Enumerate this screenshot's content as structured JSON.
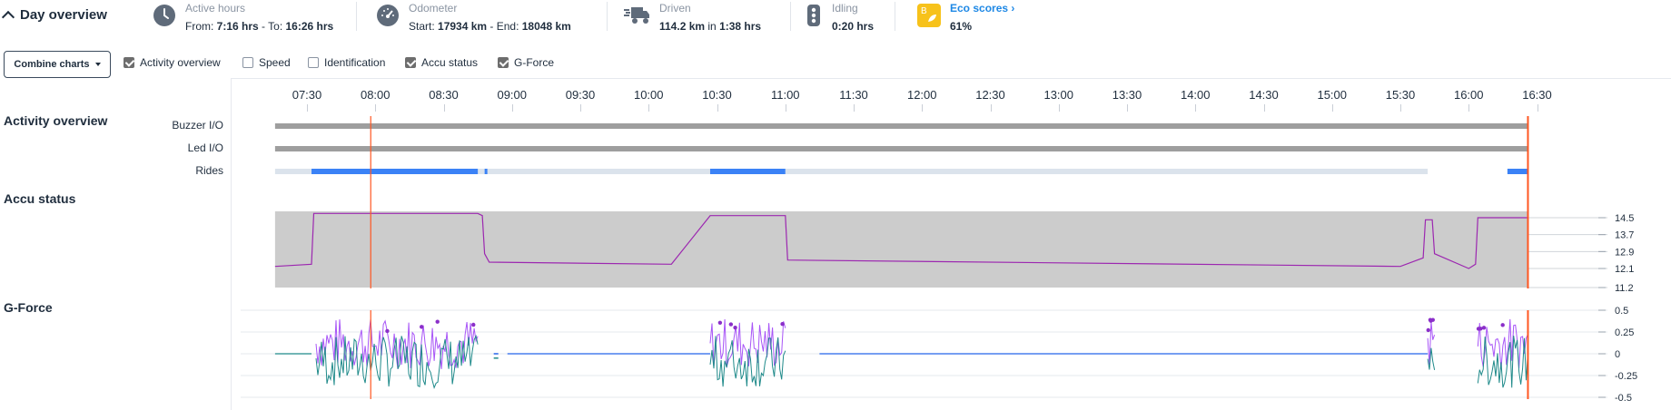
{
  "header": {
    "title": "Day overview",
    "stats": [
      {
        "icon": "clock-icon",
        "label": "Active hours",
        "prefix1": "From: ",
        "v1": "7:16 hrs",
        "mid": " - To: ",
        "v2": "16:26 hrs"
      },
      {
        "icon": "speedometer-icon",
        "label": "Odometer",
        "prefix1": "Start: ",
        "v1": "17934 km",
        "mid": " - End: ",
        "v2": "18048 km"
      },
      {
        "icon": "truck-icon",
        "label": "Driven",
        "prefix1": "",
        "v1": "114.2 km",
        "mid": " in ",
        "v2": "1:38 hrs"
      },
      {
        "icon": "traffic-light-icon",
        "label": "Idling",
        "prefix1": "",
        "v1": "0:20 hrs",
        "mid": "",
        "v2": ""
      },
      {
        "icon": "eco-badge-icon",
        "label": "Eco scores ›",
        "prefix1": "",
        "v1": "61%",
        "mid": "",
        "v2": ""
      }
    ],
    "eco_badge_letter": "B"
  },
  "controls": {
    "combine_label": "Combine charts",
    "checkboxes": [
      {
        "label": "Activity overview",
        "checked": true
      },
      {
        "label": "Speed",
        "checked": false
      },
      {
        "label": "Identification",
        "checked": false
      },
      {
        "label": "Accu status",
        "checked": true
      },
      {
        "label": "G-Force",
        "checked": true
      }
    ]
  },
  "timeline": {
    "ticks": [
      "07:30",
      "08:00",
      "08:30",
      "09:00",
      "09:30",
      "10:00",
      "10:30",
      "11:00",
      "11:30",
      "12:00",
      "12:30",
      "13:00",
      "13:30",
      "14:00",
      "14:30",
      "15:00",
      "15:30",
      "16:00",
      "16:30"
    ]
  },
  "sections": {
    "activity_title": "Activity overview",
    "accu_title": "Accu status",
    "gforce_title": "G-Force"
  },
  "activity_rows": [
    "Buzzer I/O",
    "Led I/O",
    "Rides"
  ],
  "colors": {
    "bar_gray": "#9e9e9e",
    "ride_active": "#3b82f6",
    "ride_idle": "#dbe3ec",
    "marker": "#ff5722",
    "accu_fill": "#cccccc",
    "accu_line": "#9c27b0",
    "gforce_purple": "#a855f7",
    "gforce_teal": "#1f8a8a",
    "gforce_blue": "#2563eb",
    "eco_yellow": "#f7c21b",
    "eco_blue": "#1e88e5"
  },
  "chart_data": [
    {
      "type": "bar",
      "title": "Activity overview",
      "x_unit": "time",
      "series": [
        {
          "name": "Buzzer I/O",
          "segments": [
            [
              "07:16",
              "16:26"
            ]
          ]
        },
        {
          "name": "Led I/O",
          "segments": [
            [
              "07:16",
              "16:26"
            ]
          ]
        },
        {
          "name": "Rides",
          "active": [
            [
              "07:32",
              "08:45"
            ],
            [
              "08:48",
              "08:49"
            ],
            [
              "10:27",
              "11:00"
            ],
            [
              "16:17",
              "16:26"
            ]
          ],
          "idle": [
            [
              "07:16",
              "15:42"
            ],
            [
              "16:17",
              "16:26"
            ]
          ]
        }
      ],
      "marker_time": "07:58"
    },
    {
      "type": "line",
      "title": "Accu status",
      "ylim": [
        11.2,
        14.8
      ],
      "yticks": [
        14.5,
        13.7,
        12.9,
        12.1,
        11.2
      ],
      "x": [
        "07:16",
        "07:32",
        "07:33",
        "08:45",
        "08:47",
        "08:48",
        "08:50",
        "10:10",
        "10:27",
        "11:00",
        "11:01",
        "15:30",
        "15:40",
        "15:41",
        "15:44",
        "15:45",
        "16:00",
        "16:03",
        "16:04",
        "16:26"
      ],
      "values": [
        12.2,
        12.3,
        14.7,
        14.7,
        14.6,
        12.8,
        12.4,
        12.3,
        14.6,
        14.6,
        12.5,
        12.2,
        12.6,
        14.4,
        14.4,
        12.8,
        12.1,
        12.3,
        14.5,
        14.5
      ]
    },
    {
      "type": "line",
      "title": "G-Force",
      "ylim": [
        -0.5,
        0.5
      ],
      "yticks": [
        0.5,
        0.25,
        0,
        -0.25,
        -0.5
      ],
      "x": [
        "07:16",
        "07:32",
        "08:45",
        "10:27",
        "11:00",
        "15:42",
        "16:26"
      ],
      "values": [
        0,
        0.4,
        0,
        0.4,
        0,
        0.3,
        0.3
      ]
    }
  ]
}
